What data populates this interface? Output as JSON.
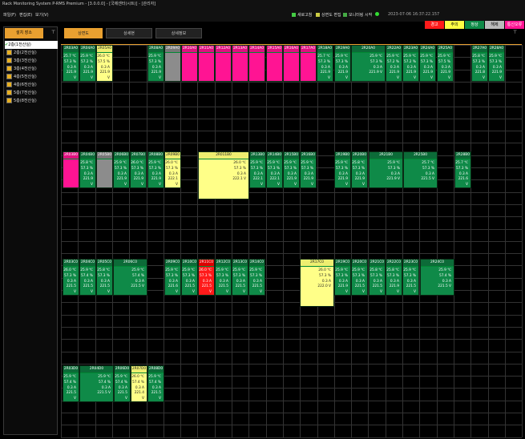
{
  "app": {
    "title": "Rack Monitoring System P-RMS Premium - [3.0.0.0] - [국제센터(시트)] - [관리자]",
    "menu": [
      "파일(F)",
      "편집(E)",
      "보기(V)"
    ],
    "toolbar": {
      "refresh": "새로고침",
      "edit": "상면도 편집",
      "monitor": "모니터링 시작"
    },
    "datetime": "2023-07-06 16:37:22.157",
    "status": {
      "alarm": "경고",
      "caution": "주의",
      "normal": "정상",
      "release": "해제",
      "comm_error": "통신오류"
    },
    "colors": {
      "normal": "#0f8a48",
      "caution": "#ffff88",
      "alarm": "#ff1a1a",
      "comm_error": "#ff1493",
      "release": "#8c8c8c"
    }
  },
  "sidebar": {
    "tab": "설치 장소",
    "items": [
      "2층(1전산실)",
      "2층(2전산실)",
      "3층(3전산실)",
      "3층(4전산실)",
      "4층(5전산실)",
      "4층(6전산실)",
      "5층(7전산실)",
      "5층(8전산실)"
    ]
  },
  "tabs": [
    "상면도",
    "상세현",
    "상세정보"
  ],
  "racks": [
    {
      "id": "2R03A0",
      "s": "g",
      "t": "25.7",
      "h": "57.3",
      "a": "0.3",
      "v": "221.9"
    },
    {
      "id": "2R04A0",
      "s": "g",
      "t": "25.9",
      "h": "57.2",
      "a": "0.3",
      "v": "221.9"
    },
    {
      "id": "2R05A0",
      "s": "y",
      "t": "26.0",
      "h": "57.5",
      "a": "0.3",
      "v": "221.9"
    },
    {
      "id": "2R08A0",
      "s": "g",
      "t": "25.9",
      "h": "57.3",
      "a": "0.3",
      "v": "221.9"
    },
    {
      "id": "2R09A0",
      "s": "gr",
      "t": "",
      "h": "",
      "a": "",
      "v": ""
    },
    {
      "id": "2R10A0",
      "s": "p",
      "t": "",
      "h": "",
      "a": "",
      "v": ""
    },
    {
      "id": "2R11A0",
      "s": "p",
      "t": "",
      "h": "",
      "a": "",
      "v": ""
    },
    {
      "id": "2R12A0",
      "s": "p",
      "t": "",
      "h": "",
      "a": "",
      "v": ""
    },
    {
      "id": "2R13A0",
      "s": "p",
      "t": "",
      "h": "",
      "a": "",
      "v": ""
    },
    {
      "id": "2R14A0",
      "s": "p",
      "t": "",
      "h": "",
      "a": "",
      "v": ""
    },
    {
      "id": "2R15A0",
      "s": "p",
      "t": "",
      "h": "",
      "a": "",
      "v": ""
    },
    {
      "id": "2R16A0",
      "s": "p",
      "t": "",
      "h": "",
      "a": "",
      "v": ""
    },
    {
      "id": "2R17A0",
      "s": "p",
      "t": "",
      "h": "",
      "a": "",
      "v": ""
    },
    {
      "id": "2R18A0",
      "s": "g",
      "t": "25.7",
      "h": "57.3",
      "a": "0.3",
      "v": "221.9"
    },
    {
      "id": "2R19A0",
      "s": "g",
      "t": "25.9",
      "h": "57.3",
      "a": "0.3",
      "v": "221.9"
    },
    {
      "id": "2R20A0",
      "s": "g",
      "t": "25.9",
      "h": "57.3",
      "a": "0.3",
      "v": "221.9"
    },
    {
      "id": "2R22A0",
      "s": "g",
      "t": "25.9",
      "h": "57.2",
      "a": "0.3",
      "v": "221.9"
    },
    {
      "id": "2R23A0",
      "s": "g",
      "t": "25.9",
      "h": "57.2",
      "a": "0.3",
      "v": "221.9"
    },
    {
      "id": "2R24A0",
      "s": "g",
      "t": "25.9",
      "h": "57.3",
      "a": "0.3",
      "v": "221.9"
    },
    {
      "id": "2R25A0",
      "s": "g",
      "t": "25.9",
      "h": "57.5",
      "a": "0.3",
      "v": "221.9"
    },
    {
      "id": "2R27A0",
      "s": "g",
      "t": "25.8",
      "h": "57.3",
      "a": "0.3",
      "v": "221.8"
    },
    {
      "id": "2R28A0",
      "s": "g",
      "t": "25.9",
      "h": "57.3",
      "a": "0.3",
      "v": "221.9"
    },
    {
      "id": "2R03B0",
      "s": "p",
      "t": "",
      "h": "",
      "a": "",
      "v": ""
    },
    {
      "id": "2R04B0",
      "s": "g",
      "t": "25.8",
      "h": "57.3",
      "a": "0.3",
      "v": "221.9"
    },
    {
      "id": "2R05B0",
      "s": "gr",
      "t": "",
      "h": "",
      "a": "",
      "v": ""
    },
    {
      "id": "2R06B0",
      "s": "g",
      "t": "25.9",
      "h": "57.3",
      "a": "0.3",
      "v": "221.9"
    },
    {
      "id": "2R07B0",
      "s": "g",
      "t": "26.0",
      "h": "57.3",
      "a": "0.3",
      "v": "221.9"
    },
    {
      "id": "2R08B0",
      "s": "g",
      "t": "25.9",
      "h": "57.3",
      "a": "0.3",
      "v": "221.9"
    },
    {
      "id": "2R09B0",
      "s": "y",
      "t": "26.0",
      "h": "57.3",
      "a": "0.3",
      "v": "222.1"
    },
    {
      "id": "2R011B0",
      "s": "y",
      "t": "26.0",
      "h": "57.3",
      "a": "0.3",
      "v": "222.1"
    },
    {
      "id": "2R13B0",
      "s": "g",
      "t": "25.9",
      "h": "57.3",
      "a": "0.3",
      "v": "222.1"
    },
    {
      "id": "2R14B0",
      "s": "g",
      "t": "25.9",
      "h": "57.3",
      "a": "0.3",
      "v": "222.1"
    },
    {
      "id": "2R15B0",
      "s": "g",
      "t": "25.9",
      "h": "57.3",
      "a": "0.3",
      "v": "221.9"
    },
    {
      "id": "2R16B0",
      "s": "g",
      "t": "25.9",
      "h": "57.3",
      "a": "0.3",
      "v": "221.9"
    },
    {
      "id": "2R19B0",
      "s": "g",
      "t": "25.9",
      "h": "57.3",
      "a": "0.3",
      "v": "221.9"
    },
    {
      "id": "2R20B0",
      "s": "g",
      "t": "25.8",
      "h": "57.3",
      "a": "0.3",
      "v": "221.9"
    },
    {
      "id": "2R21B0",
      "s": "g",
      "t": "25.9",
      "h": "57.3",
      "a": "0.3",
      "v": "221.9"
    },
    {
      "id": "2R25B0",
      "s": "g",
      "t": "25.7",
      "h": "57.3",
      "a": "0.3",
      "v": "221.5"
    },
    {
      "id": "2R28B0",
      "s": "g",
      "t": "25.7",
      "h": "57.3",
      "a": "0.3",
      "v": "221.6"
    },
    {
      "id": "2R03C0",
      "s": "g",
      "t": "26.0",
      "h": "57.3",
      "a": "0.3",
      "v": "221.5"
    },
    {
      "id": "2R04C0",
      "s": "g",
      "t": "25.9",
      "h": "57.4",
      "a": "0.3",
      "v": "221.5"
    },
    {
      "id": "2R05C0",
      "s": "g",
      "t": "25.8",
      "h": "57.3",
      "a": "0.3",
      "v": "221.5"
    },
    {
      "id": "2R06C0",
      "s": "g",
      "t": "25.9",
      "h": "57.4",
      "a": "0.3",
      "v": "221.5"
    },
    {
      "id": "2R09C0",
      "s": "g",
      "t": "25.9",
      "h": "57.3",
      "a": "0.3",
      "v": "221.6"
    },
    {
      "id": "2R10C0",
      "s": "g",
      "t": "25.9",
      "h": "57.3",
      "a": "0.3",
      "v": "221.5"
    },
    {
      "id": "2R11C0",
      "s": "r",
      "t": "26.0",
      "h": "57.3",
      "a": "0.3",
      "v": "221.5"
    },
    {
      "id": "2R12C0",
      "s": "g",
      "t": "25.9",
      "h": "57.3",
      "a": "0.3",
      "v": "221.5"
    },
    {
      "id": "2R13C0",
      "s": "g",
      "t": "25.9",
      "h": "57.3",
      "a": "0.3",
      "v": "221.5"
    },
    {
      "id": "2R14C0",
      "s": "g",
      "t": "25.9",
      "h": "57.3",
      "a": "0.3",
      "v": "221.5"
    },
    {
      "id": "2R17C0",
      "s": "y",
      "t": "26.0",
      "h": "57.3",
      "a": "0.3",
      "v": "222.0"
    },
    {
      "id": "2R19C0",
      "s": "g",
      "t": "25.9",
      "h": "57.3",
      "a": "0.3",
      "v": "221.9"
    },
    {
      "id": "2R20C0",
      "s": "g",
      "t": "25.9",
      "h": "57.3",
      "a": "0.3",
      "v": "221.5"
    },
    {
      "id": "2R21C0",
      "s": "g",
      "t": "25.8",
      "h": "57.3",
      "a": "0.3",
      "v": "221.5"
    },
    {
      "id": "2R22C0",
      "s": "g",
      "t": "25.8",
      "h": "57.3",
      "a": "0.3",
      "v": "221.9"
    },
    {
      "id": "2R23C0",
      "s": "g",
      "t": "25.9",
      "h": "57.3",
      "a": "0.3",
      "v": "221.5"
    },
    {
      "id": "2R24C0",
      "s": "g",
      "t": "25.9",
      "h": "57.4",
      "a": "0.3",
      "v": "221.5"
    },
    {
      "id": "2R03D0",
      "s": "g",
      "t": "25.9",
      "h": "57.4",
      "a": "0.3",
      "v": "221.5"
    },
    {
      "id": "2R04D0",
      "s": "g",
      "t": "25.9",
      "h": "57.4",
      "a": "0.3",
      "v": "221.5"
    },
    {
      "id": "2R06D0",
      "s": "g",
      "t": "25.9",
      "h": "57.4",
      "a": "0.3",
      "v": "221.5"
    },
    {
      "id": "2R07D0",
      "s": "y",
      "t": "26.0",
      "h": "57.4",
      "a": "0.3",
      "v": "221.4"
    },
    {
      "id": "2R08D0",
      "s": "g",
      "t": "25.9",
      "h": "57.4",
      "a": "0.3",
      "v": "221.5"
    }
  ]
}
